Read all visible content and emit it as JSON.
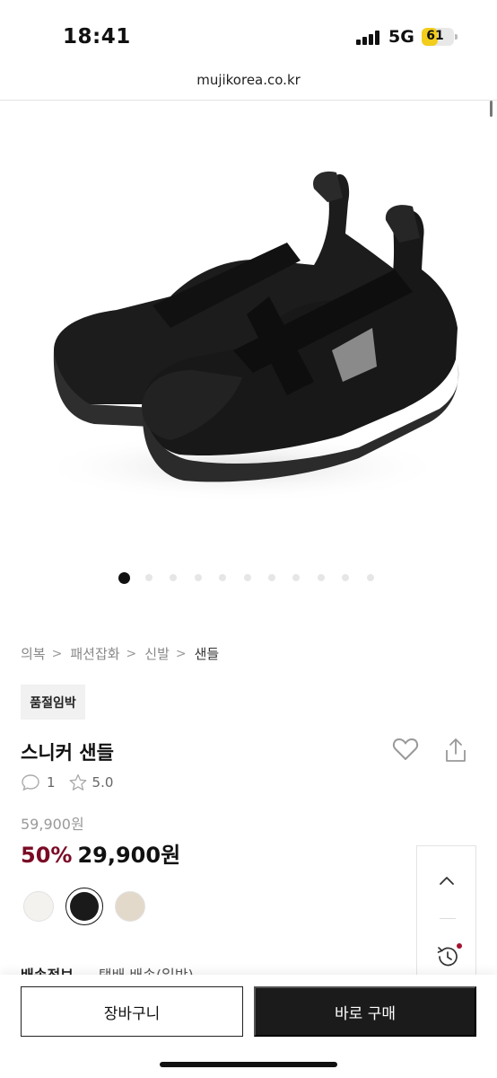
{
  "status_bar": {
    "time": "18:41",
    "network": "5G",
    "battery": "61",
    "battery_level": 0.61
  },
  "browser": {
    "url": "mujikorea.co.kr"
  },
  "carousel": {
    "total": 11,
    "active_index": 0
  },
  "breadcrumb": {
    "items": [
      "의복",
      "패션잡화",
      "신발",
      "샌들"
    ]
  },
  "product": {
    "badge": "품절임박",
    "title": "스니커 샌들",
    "review_count": "1",
    "rating": "5.0",
    "original_price": "59,900원",
    "discount": "50%",
    "sale_price": "29,900원",
    "colors": [
      {
        "name": "white",
        "hex": "#f4f2ef"
      },
      {
        "name": "black",
        "hex": "#1a1a1a",
        "selected": true
      },
      {
        "name": "beige",
        "hex": "#e3d9cb"
      }
    ]
  },
  "shipping": {
    "label": "배송정보",
    "value": "택배 배송(일반)"
  },
  "actions": {
    "cart_label": "장바구니",
    "buy_label": "바로 구매"
  },
  "icons": {
    "heart": "heart-icon",
    "share": "share-icon",
    "comment": "comment-icon",
    "star": "star-icon",
    "scroll_top": "chevron-up-icon",
    "history": "history-icon"
  },
  "colors": {
    "discount": "#7a0a24",
    "buy_button": "#1b1b1b",
    "battery": "#f2cd1c"
  }
}
